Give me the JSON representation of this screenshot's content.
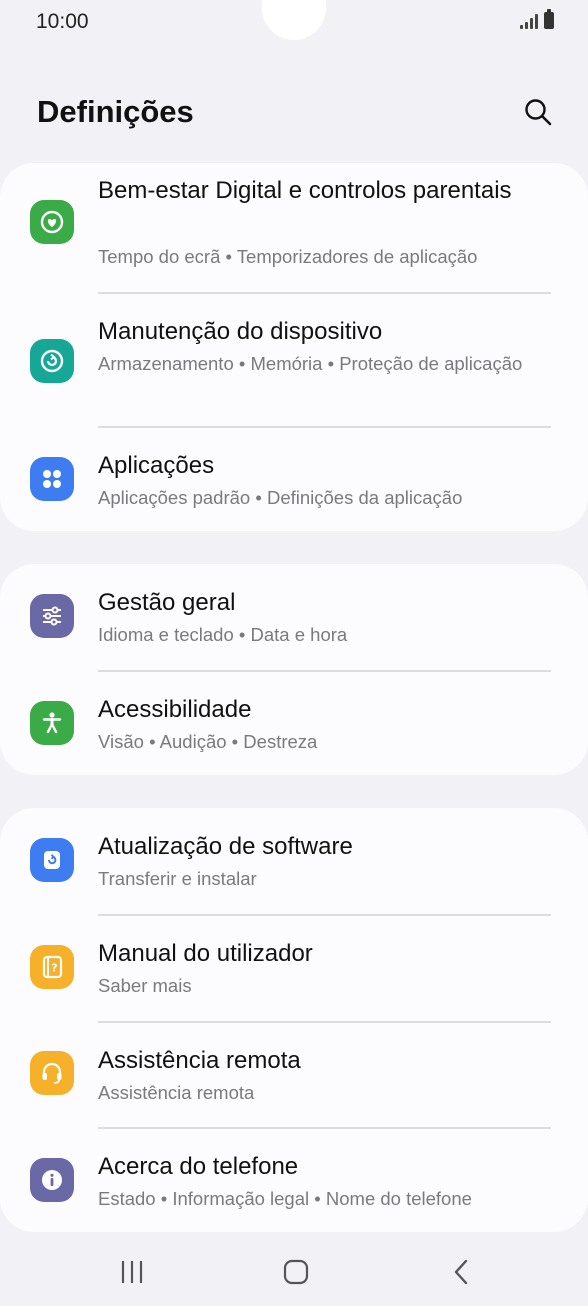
{
  "status_bar": {
    "time": "10:00"
  },
  "header": {
    "title": "Definições"
  },
  "groups": [
    {
      "items": [
        {
          "title": "Bem-estar Digital e controlos parentais",
          "subtitle": "Tempo do ecrã  •  Temporizadores de aplicação",
          "icon": "digital-wellbeing-icon",
          "color": "#3bab48"
        },
        {
          "title": "Manutenção do dispositivo",
          "subtitle": "Armazenamento  •  Memória  •  Proteção de aplicação",
          "icon": "device-care-icon",
          "color": "#16a796"
        },
        {
          "title": "Aplicações",
          "subtitle": "Aplicações padrão  •  Definições da aplicação",
          "icon": "apps-icon",
          "color": "#3d7cf1"
        }
      ]
    },
    {
      "items": [
        {
          "title": "Gestão geral",
          "subtitle": "Idioma e teclado  •  Data e hora",
          "icon": "general-management-icon",
          "color": "#6b68a6"
        },
        {
          "title": "Acessibilidade",
          "subtitle": "Visão  •  Audição  •  Destreza",
          "icon": "accessibility-icon",
          "color": "#3bab48"
        }
      ]
    },
    {
      "items": [
        {
          "title": "Atualização de software",
          "subtitle": "Transferir e instalar",
          "icon": "software-update-icon",
          "color": "#3d7cf1"
        },
        {
          "title": "Manual do utilizador",
          "subtitle": "Saber mais",
          "icon": "user-manual-icon",
          "color": "#f6b02a"
        },
        {
          "title": "Assistência remota",
          "subtitle": "Assistência remota",
          "icon": "remote-support-icon",
          "color": "#f6b02a"
        },
        {
          "title": "Acerca do telefone",
          "subtitle": "Estado  •  Informação legal  •  Nome do telefone",
          "icon": "about-phone-icon",
          "color": "#6b68a6"
        }
      ]
    }
  ],
  "nav_bar": {
    "recents": "recents-icon",
    "home": "home-icon",
    "back": "back-icon"
  }
}
